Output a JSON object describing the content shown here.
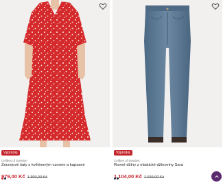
{
  "products": [
    {
      "badge": "Výprodej",
      "brand": "Cellbes of Sweden",
      "title": "Žerzejové šaty s květinovým vzorem a kapsami",
      "price": "979,00 Kč",
      "old_price": "1 399,00 Kč",
      "swatches": [
        "#d2222d",
        "#1f2a44"
      ],
      "image_icon": "red-floral-dress-image"
    },
    {
      "badge": "Výprodej",
      "brand": "Cellbes of Sweden",
      "title": "Rovné džíny z elastické džínoviny Sara",
      "price": "1 104,00 Kč",
      "old_price": "1 699,00 Kč",
      "swatches": [
        "#1f2a44",
        "#222222"
      ],
      "image_icon": "blue-jeans-image"
    }
  ],
  "icons": {
    "wishlist": "heart-outline-icon",
    "scroll_top": "chevron-up-icon"
  },
  "colors": {
    "sale": "#c4262e",
    "scroll_button": "#5b2b6e"
  }
}
